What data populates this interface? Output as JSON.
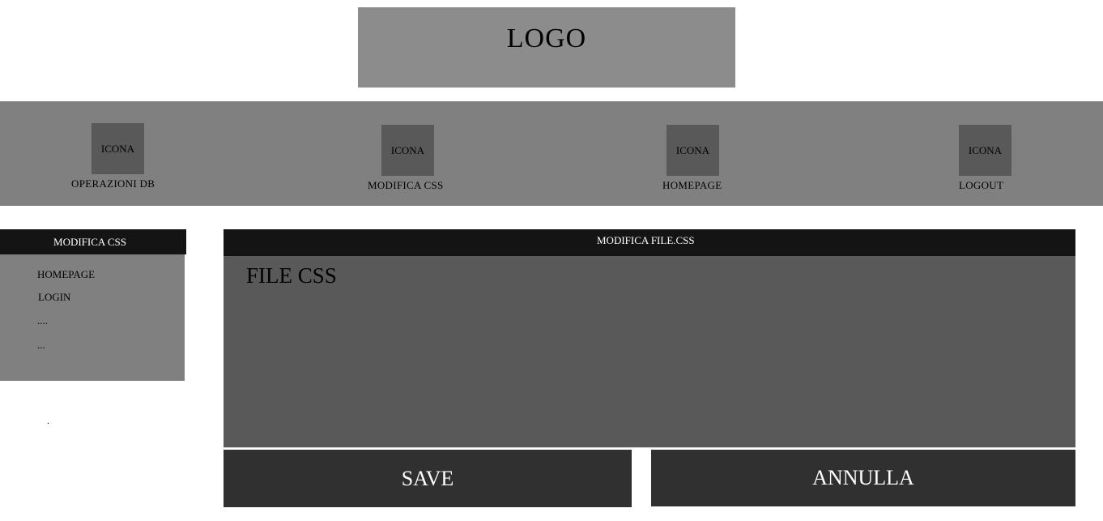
{
  "logo": {
    "text": "LOGO"
  },
  "nav": {
    "items": [
      {
        "icon": "ICONA",
        "label": "OPERAZIONI DB"
      },
      {
        "icon": "ICONA",
        "label": "MODIFICA CSS"
      },
      {
        "icon": "ICONA",
        "label": "HOMEPAGE"
      },
      {
        "icon": "ICONA",
        "label": "LOGOUT"
      }
    ]
  },
  "sidebar": {
    "title": "MODIFICA CSS",
    "items": [
      {
        "label": "HOMEPAGE"
      },
      {
        "label": "LOGIN"
      },
      {
        "label": "...."
      },
      {
        "label": "..."
      }
    ],
    "footnote": "."
  },
  "editor": {
    "title": "MODIFICA FILE.CSS",
    "content": "FILE CSS"
  },
  "actions": {
    "save_label": "SAVE",
    "cancel_label": "ANNULLA"
  },
  "colors": {
    "logo_bg": "#8c8c8c",
    "navbar_bg": "#808080",
    "icon_bg": "#595959",
    "header_bg": "#141414",
    "editor_bg": "#595959",
    "button_bg": "#303030"
  }
}
